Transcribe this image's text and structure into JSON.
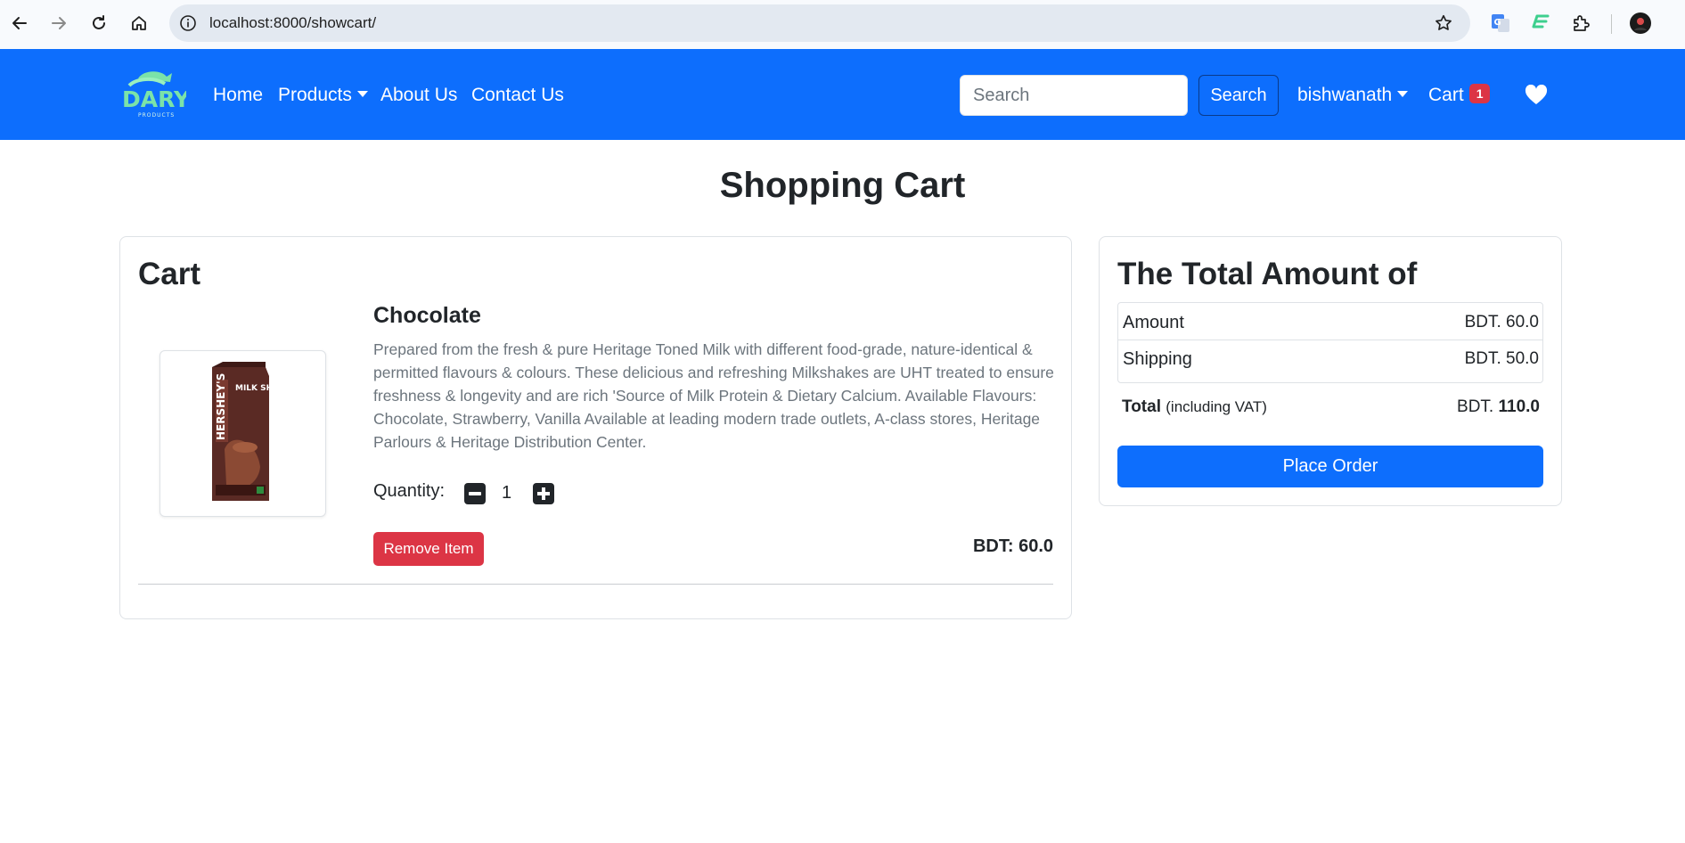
{
  "browser": {
    "url": "localhost:8000/showcart/",
    "icons": [
      "back-arrow-icon",
      "forward-arrow-icon",
      "reload-icon",
      "home-icon",
      "site-info-icon",
      "bookmark-star-icon",
      "google-translate-icon",
      "extension-icon",
      "puzzle-extensions-icon",
      "profile-avatar-icon"
    ]
  },
  "navbar": {
    "logo_text": "DARY",
    "logo_subtext": "PRODUCTS",
    "home": "Home",
    "products": "Products",
    "about": "About Us",
    "contact": "Contact Us",
    "search_placeholder": "Search",
    "search_button": "Search",
    "user": "bishwanath",
    "cart": "Cart",
    "cart_count": "1",
    "brand_color": "#0d6efd"
  },
  "page": {
    "title": "Shopping Cart"
  },
  "cart": {
    "heading": "Cart",
    "item": {
      "name": "Chocolate",
      "description": "Prepared from the fresh & pure Heritage Toned Milk with different food-grade, nature-identical & permitted flavours & colours. These delicious and refreshing Milkshakes are UHT treated to ensure freshness & longevity and are rich 'Source of Milk Protein & Dietary Calcium. Available Flavours: Chocolate, Strawberry, Vanilla Available at leading modern trade outlets, A-class stores, Heritage Parlours & Heritage Distribution Center.",
      "quantity_label": "Quantity:",
      "quantity": "1",
      "remove_label": "Remove Item",
      "price": "BDT: 60.0",
      "image_text_brand": "HERSHEY'S",
      "image_text_product": "MILK SHAKE"
    }
  },
  "summary": {
    "heading": "The Total Amount of",
    "amount_label": "Amount",
    "amount_value": "BDT. 60.0",
    "shipping_label": "Shipping",
    "shipping_value": "BDT. 50.0",
    "total_label": "Total",
    "total_note": "(including VAT)",
    "total_currency": "BDT.",
    "total_value": "110.0",
    "place_order": "Place Order"
  }
}
